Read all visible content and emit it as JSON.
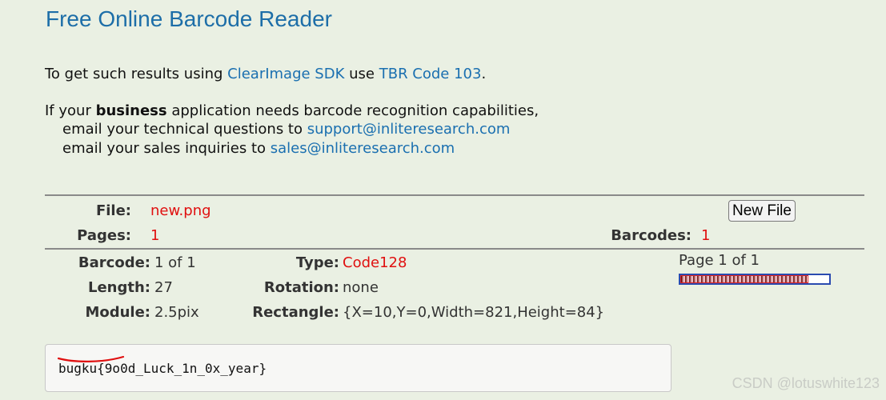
{
  "header": {
    "title": "Free Online Barcode Reader"
  },
  "intro": {
    "prefix": "To get such results using ",
    "sdk_link": "ClearImage SDK",
    "middle": " use ",
    "code_link": "TBR Code 103",
    "suffix": "."
  },
  "business": {
    "line1_prefix": "If your ",
    "line1_bold": "business",
    "line1_suffix": " application needs barcode recognition capabilities,",
    "line2_prefix": "email your technical questions to ",
    "line2_link": "support@inliteresearch.com",
    "line3_prefix": "email your sales inquiries to ",
    "line3_link": "sales@inliteresearch.com"
  },
  "file_info": {
    "file_label": "File:",
    "file_value": "new.png",
    "pages_label": "Pages:",
    "pages_value": "1",
    "barcodes_label": "Barcodes:",
    "barcodes_value": "1",
    "new_file_button": "New File"
  },
  "barcode": {
    "barcode_label": "Barcode:",
    "barcode_value": "1 of 1",
    "length_label": "Length:",
    "length_value": "27",
    "module_label": "Module:",
    "module_value": "2.5pix",
    "type_label": "Type:",
    "type_value": "Code128",
    "rotation_label": "Rotation:",
    "rotation_value": "none",
    "rectangle_label": "Rectangle:",
    "rectangle_value": "{X=10,Y=0,Width=821,Height=84}",
    "page_indicator": "Page 1 of 1"
  },
  "result": {
    "text": "bugku{9o0d_Luck_1n_0x_year}"
  },
  "watermark": {
    "text": "CSDN @lotuswhite123"
  },
  "colors": {
    "link": "#1a6fb0",
    "accent_red": "#e01010",
    "background": "#eaf0e3"
  }
}
